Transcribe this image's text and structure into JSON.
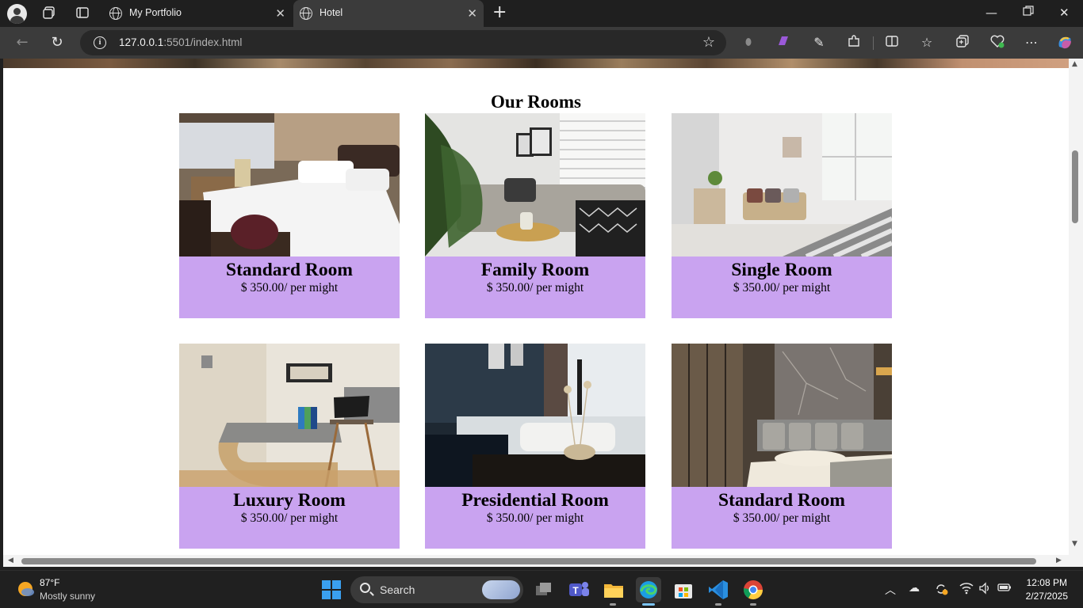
{
  "browser": {
    "tabs": [
      {
        "title": "My Portfolio",
        "active": false
      },
      {
        "title": "Hotel",
        "active": true
      }
    ],
    "url_host": "127.0.0.1",
    "url_rest": ":5501/index.html"
  },
  "page": {
    "section_title": "Our Rooms",
    "rooms": [
      {
        "name": "Standard Room",
        "price": "$ 350.00/ per might"
      },
      {
        "name": "Family Room",
        "price": "$ 350.00/ per might"
      },
      {
        "name": "Single Room",
        "price": "$ 350.00/ per might"
      },
      {
        "name": "Luxury Room",
        "price": "$ 350.00/ per might"
      },
      {
        "name": "Presidential Room",
        "price": "$ 350.00/ per might"
      },
      {
        "name": "Standard Room",
        "price": "$ 350.00/ per might"
      }
    ],
    "info_bar_color": "#c9a3f0"
  },
  "taskbar": {
    "weather_temp": "87°F",
    "weather_desc": "Mostly sunny",
    "search_label": "Search",
    "time": "12:08 PM",
    "date": "2/27/2025"
  }
}
